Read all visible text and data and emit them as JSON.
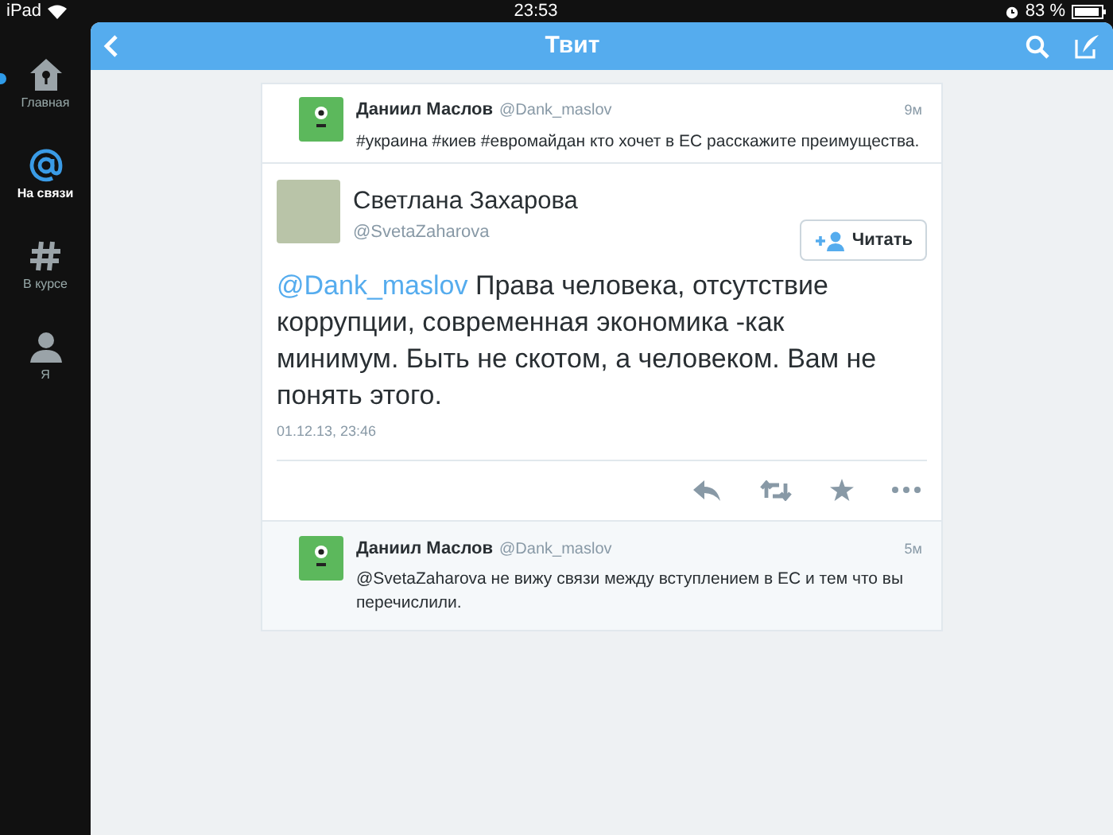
{
  "status_bar": {
    "device": "iPad",
    "time": "23:53",
    "battery": "83 %"
  },
  "sidebar": {
    "items": [
      {
        "kind": "home",
        "label": "Главная",
        "selected": false,
        "unread": true
      },
      {
        "kind": "at",
        "label": "На связи",
        "selected": true,
        "unread": false
      },
      {
        "kind": "hashtag",
        "label": "В курсе",
        "selected": false,
        "unread": false
      },
      {
        "kind": "person",
        "label": "Я",
        "selected": false,
        "unread": false
      }
    ]
  },
  "header": {
    "title": "Твит"
  },
  "context_tweet": {
    "name": "Даниил Маслов",
    "handle": "@Dank_maslov",
    "time": "9м",
    "text": "#украина #киев #евромайдан кто хочет в ЕС расскажите преимущества."
  },
  "main_tweet": {
    "name": "Светлана Захарова",
    "handle": "@SvetaZaharova",
    "follow_label": "Читать",
    "mention": "@Dank_maslov",
    "text": "Права человека, отсутствие коррупции, современная экономика -как минимум. Быть не скотом, а человеком. Вам не понять этого.",
    "timestamp": "01.12.13, 23:46"
  },
  "replies": [
    {
      "name": "Даниил Маслов",
      "handle": "@Dank_maslov",
      "time": "5м",
      "text": "@SvetaZaharova не вижу связи между вступлением в ЕС и тем что вы перечислили."
    }
  ]
}
